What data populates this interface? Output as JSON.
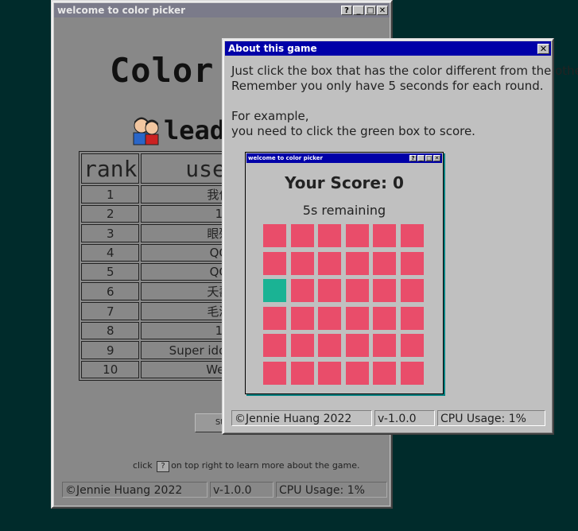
{
  "main_window": {
    "title": "welcome to color picker",
    "heading": "Color P",
    "leaderboard_label": "leade",
    "table": {
      "headers": [
        "rank",
        "usern"
      ],
      "rows": [
        {
          "rank": "1",
          "user": "我作"
        },
        {
          "rank": "2",
          "user": "1"
        },
        {
          "rank": "3",
          "user": "眼殘"
        },
        {
          "rank": "4",
          "user": "QQ"
        },
        {
          "rank": "5",
          "user": "QQ"
        },
        {
          "rank": "6",
          "user": "夭壽"
        },
        {
          "rank": "7",
          "user": "毛澤"
        },
        {
          "rank": "8",
          "user": "1"
        },
        {
          "rank": "9",
          "user": "Super idol 的笑容"
        },
        {
          "rank": "10",
          "user": "Wee"
        }
      ]
    },
    "start_button": "St",
    "hint_before": "click",
    "hint_icon": "?",
    "hint_after": "on top right to learn more about the game.",
    "status": [
      "©Jennie Huang 2022",
      "v-1.0.0",
      "CPU Usage: 1%"
    ]
  },
  "about_window": {
    "title": "About this game",
    "close": "✕",
    "line1": "Just click the box that has the color different from the others.",
    "line2": "Remember you only have 5 seconds for each round.",
    "line3": "For example,",
    "line4": "you need to click the green box to score.",
    "example": {
      "title": "welcome to color picker",
      "score": "Your Score: 0",
      "remaining": "5s remaining",
      "grid_size": 6,
      "odd_cell_index": 12,
      "base_color": "#e94d6a",
      "odd_color": "#1ab394"
    },
    "status": [
      "©Jennie Huang 2022",
      "v-1.0.0",
      "CPU Usage: 1%"
    ]
  },
  "title_buttons": [
    "?",
    "_",
    "□",
    "✕"
  ]
}
